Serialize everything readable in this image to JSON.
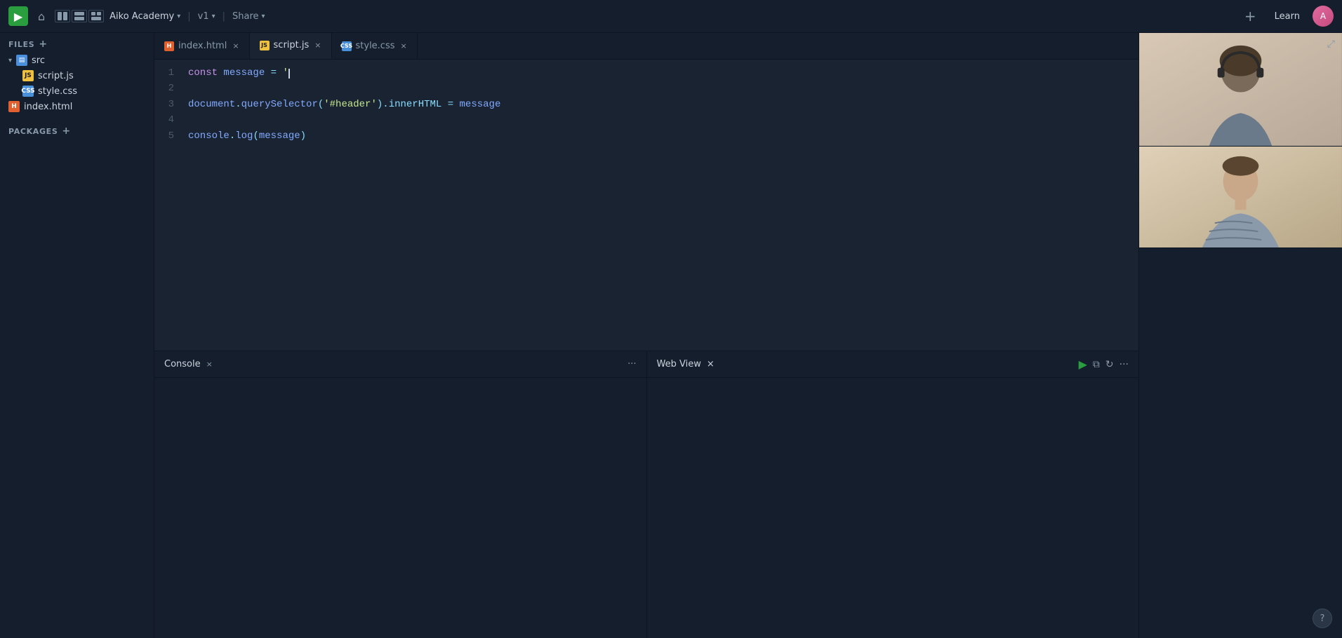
{
  "topbar": {
    "logo_symbol": "▶",
    "home_icon": "⌂",
    "project_name": "Aiko Academy",
    "project_chevron": "▾",
    "version": "v1",
    "version_chevron": "▾",
    "share": "Share",
    "share_chevron": "▾",
    "plus": "+",
    "learn": "Learn",
    "avatar_initials": "A",
    "expand_icon": "⤢"
  },
  "sidebar": {
    "files_label": "FILES",
    "files_plus": "+",
    "src_folder": "src",
    "src_folder_chevron": "▾",
    "files": [
      {
        "name": "script.js",
        "type": "js"
      },
      {
        "name": "style.css",
        "type": "css"
      }
    ],
    "root_files": [
      {
        "name": "index.html",
        "type": "html"
      }
    ],
    "packages_label": "PACKAGES",
    "packages_plus": "+"
  },
  "tabs": [
    {
      "name": "index.html",
      "type": "html",
      "active": false
    },
    {
      "name": "script.js",
      "type": "js",
      "active": true
    },
    {
      "name": "style.css",
      "type": "css",
      "active": false
    }
  ],
  "code": {
    "lines": [
      {
        "num": "1",
        "content": "const message = '"
      },
      {
        "num": "2",
        "content": ""
      },
      {
        "num": "3",
        "content": "document.querySelector('#header').innerHTML = message"
      },
      {
        "num": "4",
        "content": ""
      },
      {
        "num": "5",
        "content": "console.log(message)"
      }
    ]
  },
  "console_panel": {
    "title": "Console",
    "close": "×",
    "more": "···"
  },
  "webview_panel": {
    "title": "Web View",
    "close": "×",
    "play_btn": "▶",
    "copy_btn": "⧉",
    "refresh_btn": "↻",
    "more_btn": "···"
  },
  "help_btn": "?"
}
